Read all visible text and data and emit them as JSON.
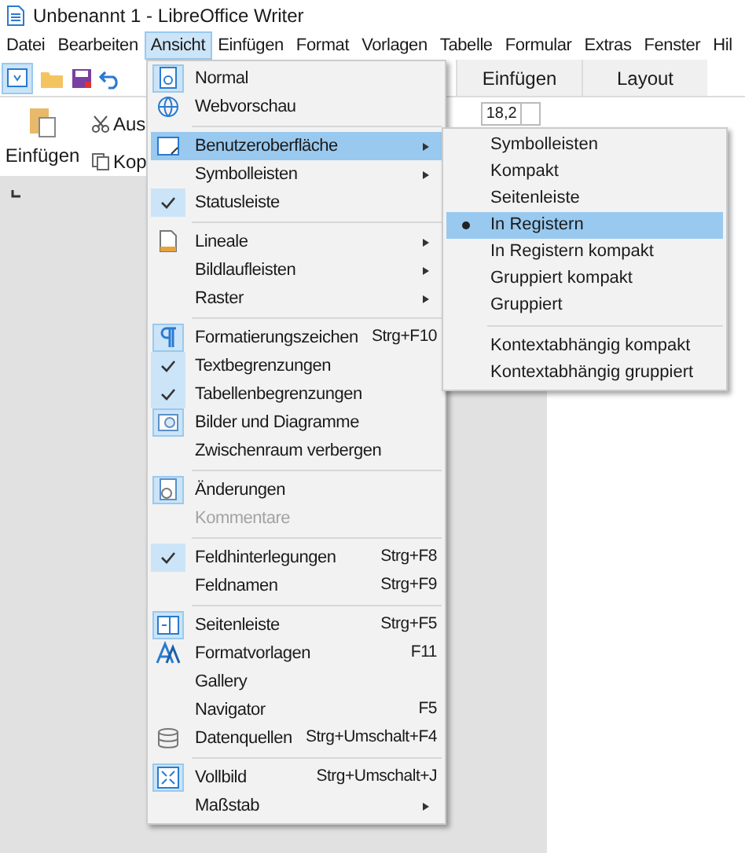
{
  "window": {
    "title": "Unbenannt 1 - LibreOffice Writer"
  },
  "menu_bar": [
    {
      "label": "Datei",
      "selected": false
    },
    {
      "label": "Bearbeiten",
      "selected": false
    },
    {
      "label": "Ansicht",
      "selected": true
    },
    {
      "label": "Einfügen",
      "selected": false
    },
    {
      "label": "Format",
      "selected": false
    },
    {
      "label": "Vorlagen",
      "selected": false
    },
    {
      "label": "Tabelle",
      "selected": false
    },
    {
      "label": "Formular",
      "selected": false
    },
    {
      "label": "Extras",
      "selected": false
    },
    {
      "label": "Fenster",
      "selected": false
    },
    {
      "label": "Hil",
      "selected": false
    }
  ],
  "toolbar_tabs": [
    {
      "label": "Einfügen"
    },
    {
      "label": "Layout"
    }
  ],
  "ribbon": {
    "paste_label": "Einfügen",
    "cut_label": "Aus",
    "copy_label": "Kop",
    "font_size": "18,2"
  },
  "view_menu": [
    [
      {
        "kind": "view",
        "label": "Normal",
        "checked": true,
        "selected": false
      },
      {
        "kind": "web",
        "label": "Webvorschau",
        "checked": false,
        "selected": false
      }
    ],
    [
      {
        "kind": "ui",
        "label": "Benutzeroberfläche",
        "submenu": true,
        "checked": false,
        "selected": true
      },
      {
        "kind": "check",
        "label": "Symbolleisten",
        "submenu": true,
        "checked": false,
        "selected": false
      },
      {
        "kind": "check",
        "label": "Statusleiste",
        "submenu": false,
        "checked": true,
        "selected": false
      }
    ],
    [
      {
        "kind": "ruler",
        "label": "Lineale",
        "submenu": true,
        "checked": false,
        "selected": false
      },
      {
        "kind": "check",
        "label": "Bildlaufleisten",
        "submenu": true,
        "checked": false,
        "selected": false
      },
      {
        "kind": "check",
        "label": "Raster",
        "submenu": true,
        "checked": false,
        "selected": false
      }
    ],
    [
      {
        "kind": "pilcrow",
        "label": "Formatierungszeichen",
        "shortcut": "Strg+F10",
        "checked": true,
        "selected": false
      },
      {
        "kind": "check",
        "label": "Textbegrenzungen",
        "checked": true,
        "selected": false
      },
      {
        "kind": "check",
        "label": "Tabellenbegrenzungen",
        "checked": true,
        "selected": false
      },
      {
        "kind": "image",
        "label": "Bilder und Diagramme",
        "checked": true,
        "selected": false
      },
      {
        "kind": "check",
        "label": "Zwischenraum verbergen",
        "checked": false,
        "selected": false
      }
    ],
    [
      {
        "kind": "track",
        "label": "Änderungen",
        "checked": true,
        "selected": false
      },
      {
        "kind": "check",
        "label": "Kommentare",
        "checked": false,
        "disabled": true,
        "selected": false
      }
    ],
    [
      {
        "kind": "check",
        "label": "Feldhinterlegungen",
        "shortcut": "Strg+F8",
        "checked": true,
        "selected": false
      },
      {
        "kind": "check",
        "label": "Feldnamen",
        "shortcut": "Strg+F9",
        "checked": false,
        "selected": false
      }
    ],
    [
      {
        "kind": "sidebar",
        "label": "Seitenleiste",
        "shortcut": "Strg+F5",
        "checked": true,
        "selected": false
      },
      {
        "kind": "styles",
        "label": "Formatvorlagen",
        "shortcut": "F11",
        "checked": false,
        "selected": false
      },
      {
        "kind": "check",
        "label": "Gallery",
        "checked": false,
        "selected": false
      },
      {
        "kind": "check",
        "label": "Navigator",
        "shortcut": "F5",
        "checked": false,
        "selected": false
      },
      {
        "kind": "database",
        "label": "Datenquellen",
        "shortcut": "Strg+Umschalt+F4",
        "checked": false,
        "selected": false
      }
    ],
    [
      {
        "kind": "fullscreen",
        "label": "Vollbild",
        "shortcut": "Strg+Umschalt+J",
        "checked": true,
        "selected": false
      },
      {
        "kind": "check",
        "label": "Maßstab",
        "submenu": true,
        "checked": false,
        "selected": false
      }
    ]
  ],
  "ui_submenu": [
    [
      {
        "label": "Symbolleisten",
        "selected": false
      },
      {
        "label": "Kompakt",
        "selected": false
      },
      {
        "label": "Seitenleiste",
        "selected": false
      },
      {
        "label": "In Registern",
        "selected": true
      },
      {
        "label": "In Registern kompakt",
        "selected": false
      },
      {
        "label": "Gruppiert kompakt",
        "selected": false
      },
      {
        "label": "Gruppiert",
        "selected": false
      }
    ],
    [
      {
        "label": "Kontextabhängig kompakt",
        "selected": false
      },
      {
        "label": "Kontextabhängig gruppiert",
        "selected": false
      }
    ]
  ]
}
